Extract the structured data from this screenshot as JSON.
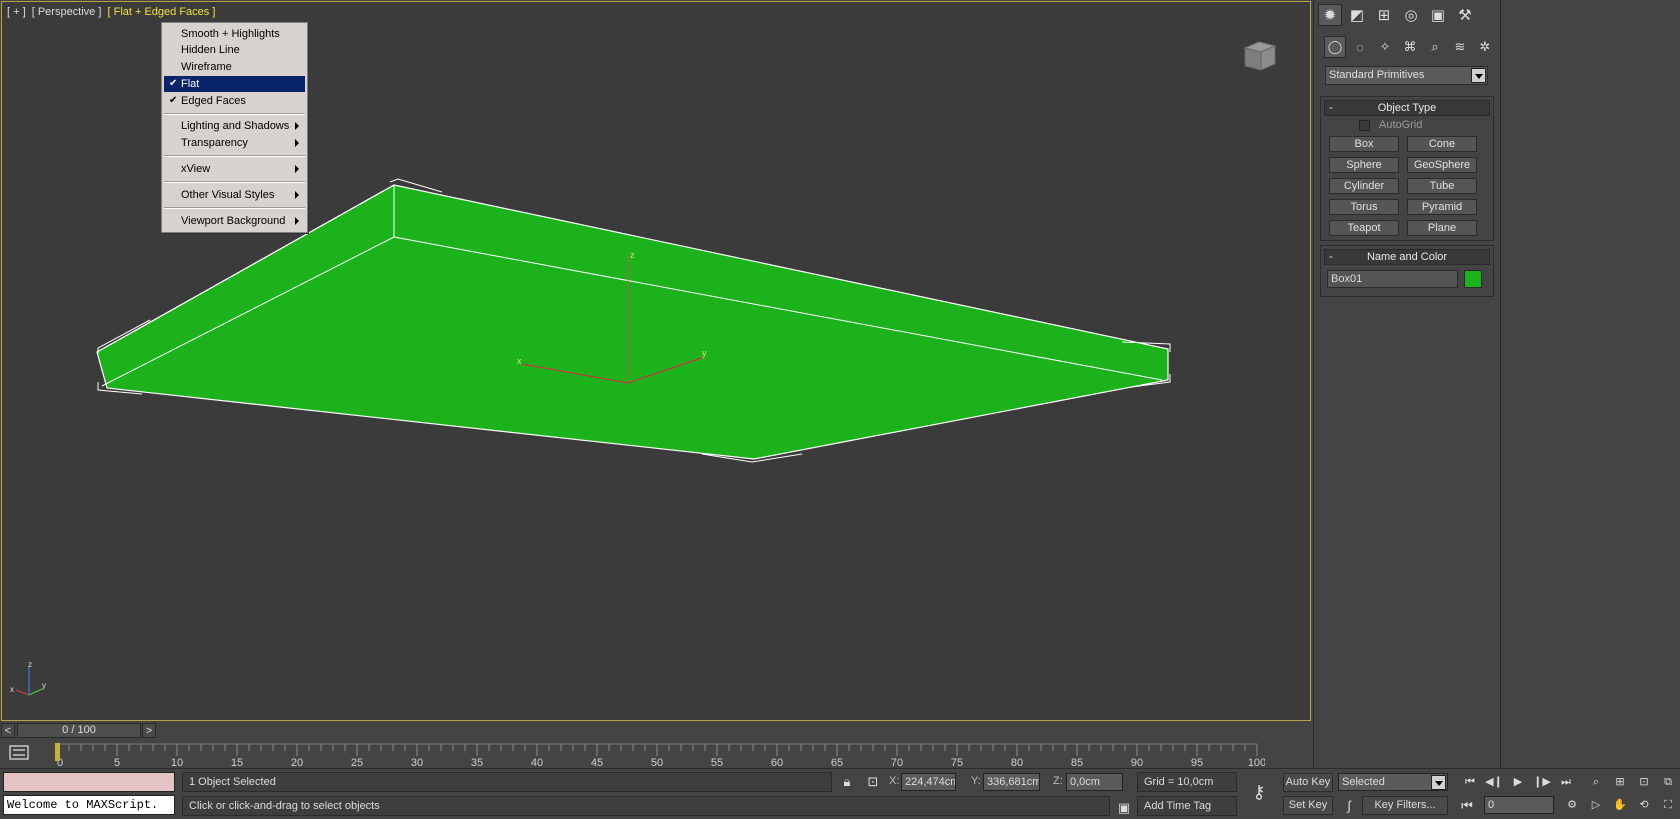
{
  "viewport": {
    "label_plus": "[ + ]",
    "label_view": "[ Perspective ]",
    "label_style": "[ Flat + Edged Faces ]"
  },
  "context_menu": {
    "items": [
      {
        "label": "Smooth + Highlights",
        "checked": false,
        "submenu": false
      },
      {
        "label": "Hidden Line",
        "checked": false,
        "submenu": false
      },
      {
        "label": "Wireframe",
        "checked": false,
        "submenu": false
      },
      {
        "label": "Flat",
        "checked": true,
        "submenu": false,
        "highlighted": true
      },
      {
        "label": "Edged Faces",
        "checked": true,
        "submenu": false
      },
      {
        "label": "Lighting and Shadows",
        "checked": false,
        "submenu": true
      },
      {
        "label": "Transparency",
        "checked": false,
        "submenu": true
      },
      {
        "label": "xView",
        "checked": false,
        "submenu": true
      },
      {
        "label": "Other Visual Styles",
        "checked": false,
        "submenu": true
      },
      {
        "label": "Viewport Background",
        "checked": false,
        "submenu": true
      }
    ]
  },
  "command_panel": {
    "category": "Standard Primitives",
    "object_type": {
      "title": "Object Type",
      "autogrid": "AutoGrid",
      "buttons": [
        "Box",
        "Cone",
        "Sphere",
        "GeoSphere",
        "Cylinder",
        "Tube",
        "Torus",
        "Pyramid",
        "Teapot",
        "Plane"
      ]
    },
    "name_and_color": {
      "title": "Name and Color",
      "name": "Box01",
      "color": "#1cb21c"
    },
    "minus": "-"
  },
  "time_slider": {
    "position": "0 / 100",
    "prev": "<",
    "next": ">",
    "ticks": [
      "0",
      "5",
      "10",
      "15",
      "20",
      "25",
      "30",
      "35",
      "40",
      "45",
      "50",
      "55",
      "60",
      "65",
      "70",
      "75",
      "80",
      "85",
      "90",
      "95",
      "100"
    ]
  },
  "status": {
    "maxscript": "Welcome to MAXScript.",
    "selection": "1 Object Selected",
    "prompt": "Click or click-and-drag to select objects",
    "x_label": "X:",
    "x_value": "224,474cm",
    "y_label": "Y:",
    "y_value": "336,681cm",
    "z_label": "Z:",
    "z_value": "0,0cm",
    "grid": "Grid = 10,0cm",
    "add_time_tag": "Add Time Tag",
    "auto_key": "Auto Key",
    "set_key": "Set Key",
    "key_mode": "Selected",
    "key_filters": "Key Filters...",
    "frame": "0"
  },
  "colors": {
    "box_green": "#1cb21c",
    "viewport_border": "#b8a244",
    "menu_highlight": "#0a246a"
  }
}
